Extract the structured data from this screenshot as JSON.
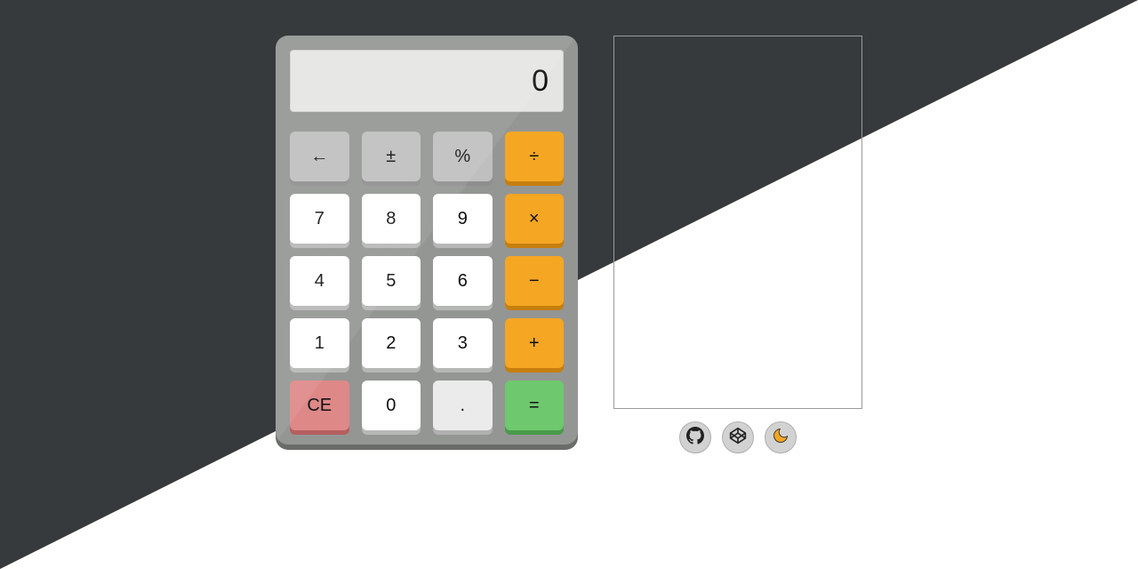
{
  "display": {
    "value": "0"
  },
  "keys": {
    "back": "←",
    "plusminus": "±",
    "percent": "%",
    "divide": "÷",
    "seven": "7",
    "eight": "8",
    "nine": "9",
    "multiply": "×",
    "four": "4",
    "five": "5",
    "six": "6",
    "minus": "−",
    "one": "1",
    "two": "2",
    "three": "3",
    "plus": "+",
    "clear": "CE",
    "zero": "0",
    "decimal": ".",
    "equals": "="
  },
  "icons": {
    "github": "github-icon",
    "codepen": "codepen-icon",
    "theme": "moon-icon"
  }
}
